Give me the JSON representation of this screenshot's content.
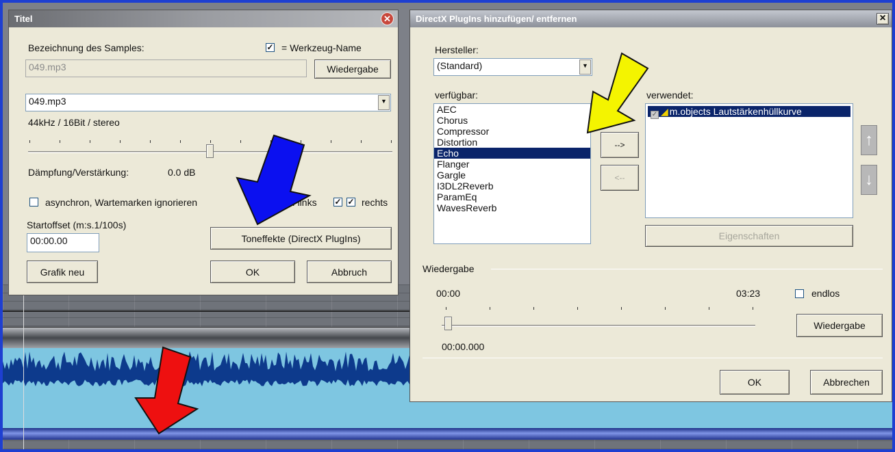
{
  "titel_dialog": {
    "title": "Titel",
    "sample_label": "Bezeichnung des Samples:",
    "tool_name_label": "= Werkzeug-Name",
    "tool_name_checked": true,
    "sample_name_value": "049.mp3",
    "play_button": "Wiedergabe",
    "file_select_value": "049.mp3",
    "format_info": "44kHz / 16Bit / stereo",
    "damping_label": "Dämpfung/Verstärkung:",
    "damping_value": "0.0 dB",
    "async_label": "asynchron, Wartemarken ignorieren",
    "async_checked": false,
    "channels_prefix": "e: links",
    "left_checked": true,
    "right_label": "rechts",
    "right_checked": true,
    "startoffset_label": "Startoffset (m:s.1/100s)",
    "startoffset_value": "00:00.00",
    "effects_button": "Toneffekte (DirectX PlugIns)",
    "redraw_button": "Grafik neu",
    "ok_button": "OK",
    "cancel_button": "Abbruch"
  },
  "directx_dialog": {
    "title": "DirectX PlugIns hinzufügen/ entfernen",
    "close_button": "×",
    "manufacturer_label": "Hersteller:",
    "manufacturer_value": "(Standard)",
    "available_label": "verfügbar:",
    "available_items": [
      "AEC",
      "Chorus",
      "Compressor",
      "Distortion",
      "Echo",
      "Flanger",
      "Gargle",
      "I3DL2Reverb",
      "ParamEq",
      "WavesReverb"
    ],
    "available_selected": "Echo",
    "used_label": "verwendet:",
    "used_items": [
      "m.objects Lautstärkenhüllkurve"
    ],
    "add_button": "-->",
    "remove_button": "<--",
    "properties_button": "Eigenschaften",
    "playback_group": "Wiedergabe",
    "time_start": "00:00",
    "time_end": "03:23",
    "loop_label": "endlos",
    "loop_checked": false,
    "position_value": "00:00.000",
    "playback_button": "Wiedergabe",
    "ok_button": "OK",
    "cancel_button": "Abbrechen"
  },
  "annotation_arrows": [
    {
      "color": "#0b10f0",
      "name": "blue-arrow"
    },
    {
      "color": "#f4f400",
      "name": "yellow-arrow"
    },
    {
      "color": "#ee1010",
      "name": "red-arrow"
    }
  ]
}
